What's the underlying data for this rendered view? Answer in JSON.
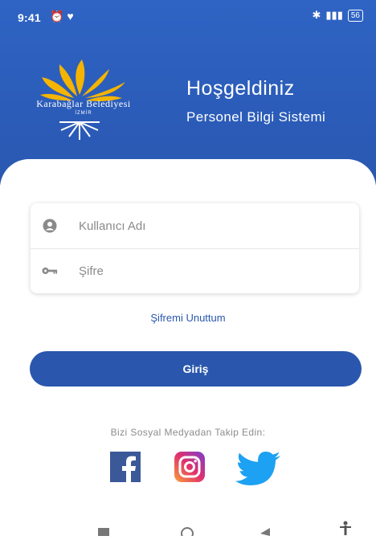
{
  "status": {
    "time": "9:41",
    "battery": "56"
  },
  "header": {
    "logo_text": "Karabağlar Belediyesi",
    "logo_sub": "İZMİR",
    "welcome": "Hoşgeldiniz",
    "system_name": "Personel Bilgi Sistemi"
  },
  "login": {
    "username_placeholder": "Kullanıcı Adı",
    "password_placeholder": "Şifre",
    "forgot_label": "Şifremi Unuttum",
    "submit_label": "Giriş"
  },
  "social": {
    "follow_text": "Bizi Sosyal Medyadan Takip Edin:",
    "items": [
      "facebook-icon",
      "instagram-icon",
      "twitter-icon"
    ]
  },
  "colors": {
    "primary": "#2a57ad",
    "header": "#2f64c4",
    "facebook": "#3b5998",
    "twitter": "#1da1f2"
  }
}
